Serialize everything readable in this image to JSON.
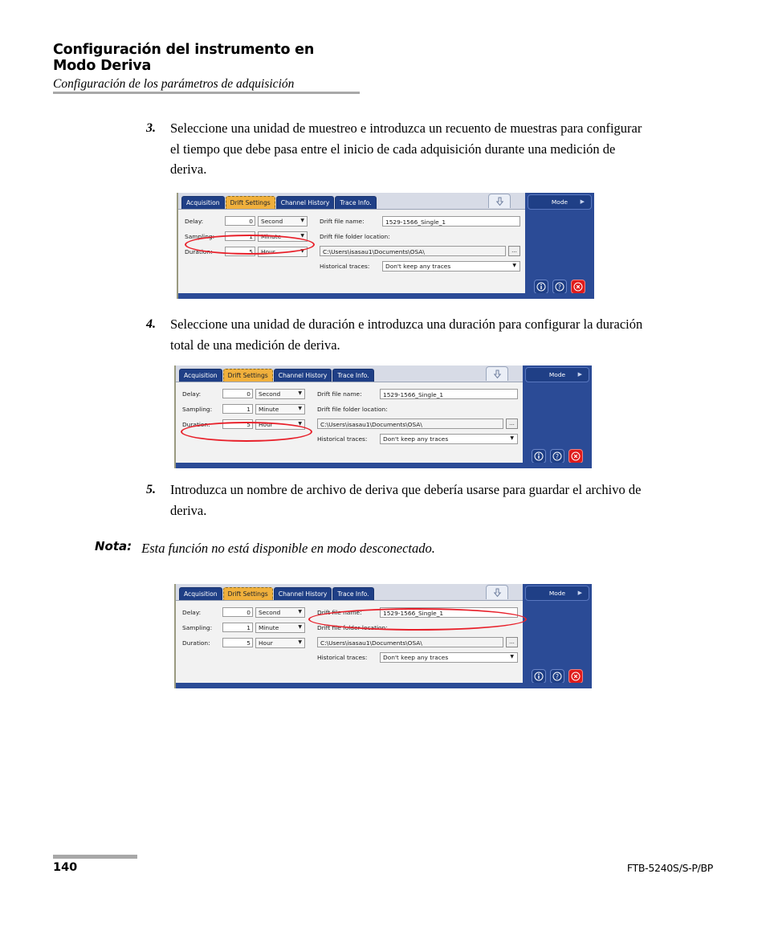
{
  "header": {
    "title": "Configuración del instrumento en Modo Deriva",
    "subtitle": "Configuración de los parámetros de adquisición"
  },
  "steps": [
    {
      "number": "3.",
      "text": "Seleccione una unidad de muestreo e introduzca un recuento de muestras para configurar el tiempo que debe pasa entre el inicio de cada adquisición durante una medición de deriva."
    },
    {
      "number": "4.",
      "text": "Seleccione una unidad de duración e introduzca una duración para configurar la duración total de una medición de deriva."
    },
    {
      "number": "5.",
      "text": "Introduzca un nombre de archivo de deriva que debería usarse para guardar el archivo de deriva."
    }
  ],
  "note": {
    "label": "Nota:",
    "text": "Esta función no está disponible en modo desconectado."
  },
  "app": {
    "tabs": [
      {
        "label": "Acquisition",
        "active": false
      },
      {
        "label": "Drift Settings",
        "active": true
      },
      {
        "label": "Channel History",
        "active": false
      },
      {
        "label": "Trace Info.",
        "active": false
      }
    ],
    "collapse_icon": "down-arrow-icon",
    "left_fields": [
      {
        "label": "Delay:",
        "value": "0",
        "unit": "Second"
      },
      {
        "label": "Sampling:",
        "value": "1",
        "unit": "Minute"
      },
      {
        "label": "Duration:",
        "value": "5",
        "unit": "Hour"
      }
    ],
    "right_fields": {
      "drift_file_name_label": "Drift file name:",
      "drift_file_name_value": "1529-1566_Single_1",
      "drift_folder_label": "Drift file folder location:",
      "drift_folder_value": "C:\\Users\\isasau1\\Documents\\OSA\\",
      "browse_label": "...",
      "historical_label": "Historical traces:",
      "historical_value": "Don't keep any traces"
    },
    "mode_panel": {
      "label": "Mode",
      "arrow": "▶",
      "buttons": [
        {
          "name": "info-button",
          "glyph": "i"
        },
        {
          "name": "help-button",
          "glyph": "?"
        },
        {
          "name": "close-button",
          "glyph": "x"
        }
      ]
    },
    "colors": {
      "tab_bar": "#d7dbe6",
      "tab_inactive": "#1f3f86",
      "tab_active": "#f0b03c",
      "mode_panel": "#2b4b96",
      "annotation": "#e8202a",
      "danger": "#e01b1b"
    }
  },
  "annotations": [
    {
      "target": "sampling-row"
    },
    {
      "target": "duration-row"
    },
    {
      "target": "drift-file-name-row"
    }
  ],
  "footer": {
    "page_number": "140",
    "model": "FTB-5240S/S-P/BP"
  }
}
